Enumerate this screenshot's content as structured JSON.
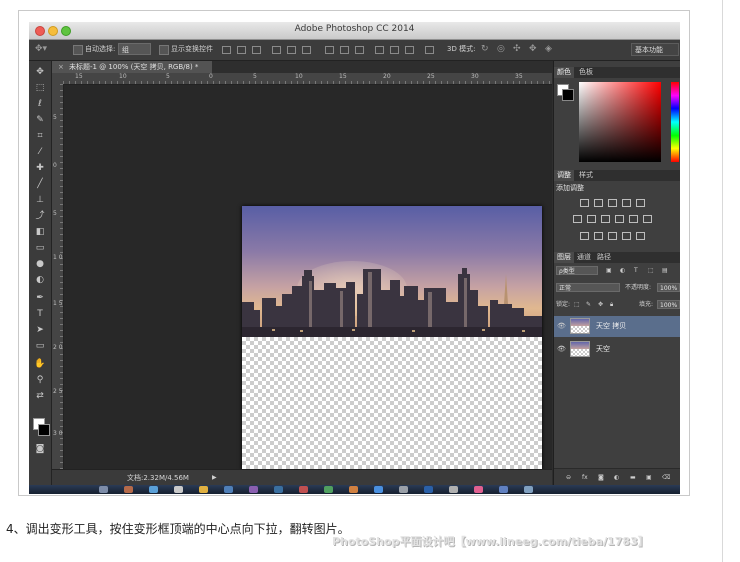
{
  "app": {
    "window_title": "Adobe Photoshop CC 2014"
  },
  "options_bar": {
    "auto_select_label": "自动选择:",
    "auto_select_value": "组",
    "show_transform_label": "显示变换控件",
    "mode_3d_label": "3D 模式:",
    "workspace": "基本功能"
  },
  "document": {
    "tab_title": "未标题-1 @ 100% (天空 拷贝, RGB/8) *",
    "close_glyph": "×",
    "status": "文档:2.32M/4.56M",
    "status_arrow": "▶"
  },
  "rulers": {
    "horizontal": [
      "15",
      "10",
      "5",
      "0",
      "5",
      "10",
      "15",
      "20",
      "25",
      "30",
      "35"
    ],
    "vertical": [
      "5",
      "0",
      "5",
      "1 0",
      "1 5",
      "2 0",
      "2 5",
      "3 0"
    ]
  },
  "panels": {
    "color_tabs": [
      "颜色",
      "色板"
    ],
    "adjust_tabs": [
      "调整",
      "样式"
    ],
    "adjust_title": "添加调整",
    "layer_tabs": [
      "图层",
      "通道",
      "路径"
    ],
    "kind_filter": "ρ类型",
    "blend_mode": "正常",
    "opacity_label": "不透明度:",
    "opacity_value": "100%",
    "lock_label": "锁定:",
    "fill_label": "填充:",
    "fill_value": "100%",
    "layers": [
      {
        "name": "天空 拷贝",
        "selected": true
      },
      {
        "name": "天空",
        "selected": false
      }
    ]
  },
  "caption": "4、调出变形工具，按住变形框顶端的中心点向下拉，翻转图片。",
  "watermark": "PhotoShop平面设计吧【www.lineeg.com/tieba/1783】",
  "colors": {
    "ps_dark": "#2e2e2e",
    "panel": "#3f3f3f",
    "selected_layer": "#5a6e8c"
  }
}
